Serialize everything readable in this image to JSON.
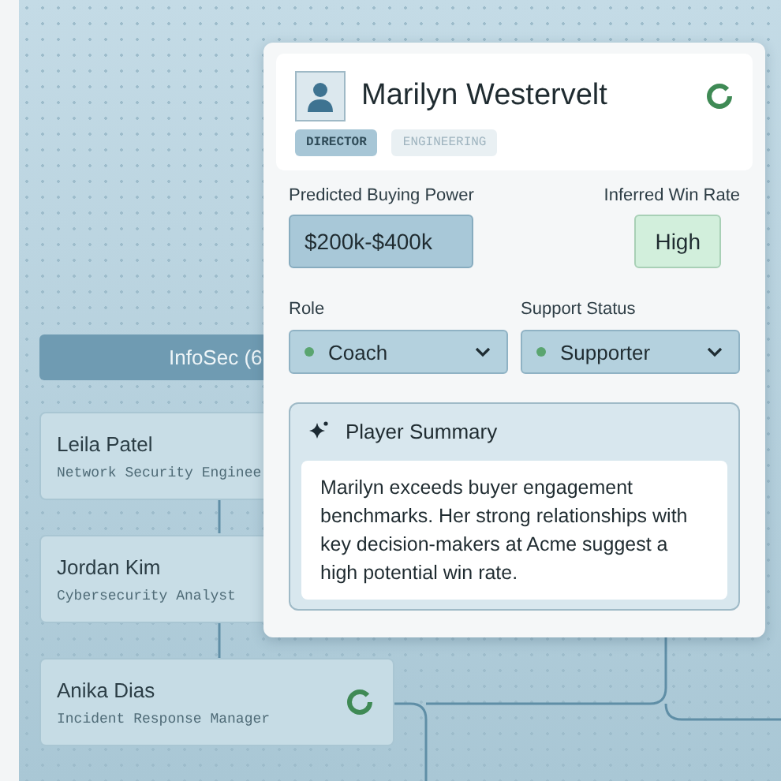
{
  "org": {
    "group": "InfoSec (6",
    "people": [
      {
        "name": "Leila Patel",
        "title": "Network Security Enginee"
      },
      {
        "name": "Jordan Kim",
        "title": "Cybersecurity Analyst"
      },
      {
        "name": "Anika Dias",
        "title": "Incident Response Manager",
        "indicator": true
      }
    ]
  },
  "profile": {
    "name": "Marilyn Westervelt",
    "tags": [
      {
        "label": "DIRECTOR",
        "selected": true
      },
      {
        "label": "ENGINEERING",
        "selected": false
      }
    ],
    "buying_power": {
      "label": "Predicted Buying Power",
      "value": "$200k-$400k"
    },
    "win_rate": {
      "label": "Inferred Win Rate",
      "value": "High"
    },
    "role": {
      "label": "Role",
      "value": "Coach"
    },
    "support": {
      "label": "Support Status",
      "value": "Supporter"
    },
    "summary": {
      "title": "Player Summary",
      "text": "Marilyn exceeds buyer engagement benchmarks. Her strong relationships with key decision-makers at Acme suggest a high potential win rate."
    }
  }
}
